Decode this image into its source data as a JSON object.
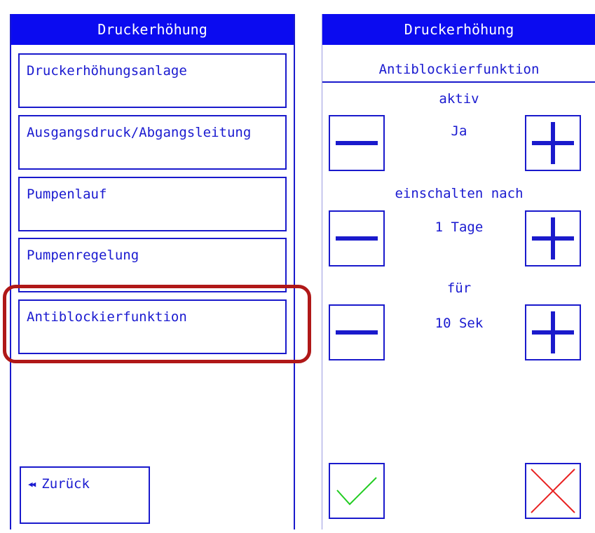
{
  "left_panel": {
    "title": "Druckerhöhung",
    "menu_items": [
      {
        "label": "Druckerhöhungsanlage"
      },
      {
        "label": "Ausgangsdruck/Abgangsleitung"
      },
      {
        "label": "Pumpenlauf"
      },
      {
        "label": "Pumpenregelung"
      },
      {
        "label": "Antiblockierfunktion"
      }
    ],
    "back_label": "Zurück",
    "highlighted_item": "Antiblockierfunktion"
  },
  "right_panel": {
    "title": "Druckerhöhung",
    "subtitle": "Antiblockierfunktion",
    "params": [
      {
        "label": "aktiv",
        "value": "Ja"
      },
      {
        "label": "einschalten nach",
        "value": "1 Tage"
      },
      {
        "label": "für",
        "value": "10 Sek"
      }
    ],
    "confirm_icon": "check-icon",
    "cancel_icon": "cross-icon"
  },
  "colors": {
    "accent": "#0b0bf0",
    "border": "#1a1acc",
    "highlight": "#b01818",
    "confirm": "#22cc22",
    "cancel": "#e82222"
  }
}
